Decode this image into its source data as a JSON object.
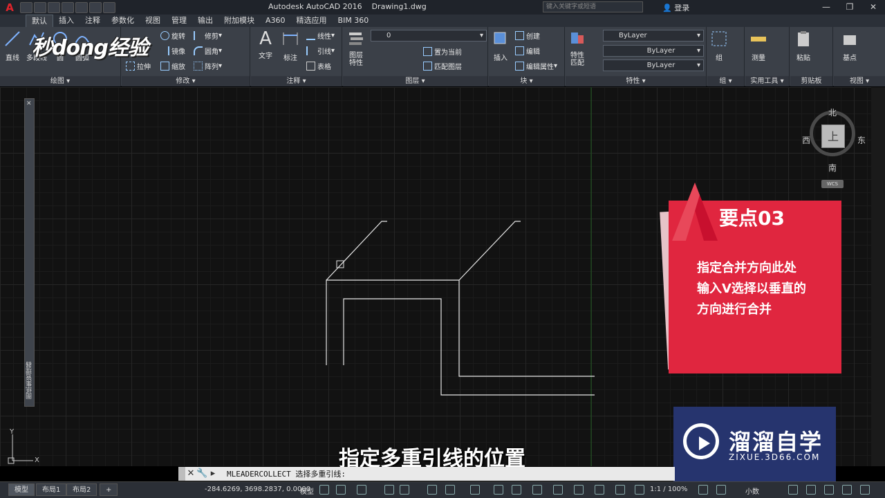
{
  "title_bar": {
    "app_title": "Autodesk AutoCAD 2016    Drawing1.dwg",
    "search_placeholder": "键入关键字或短语",
    "login_label": "登录",
    "minimize": "—",
    "restore": "❐",
    "close": "✕"
  },
  "ribbon_tabs": [
    "默认",
    "插入",
    "注释",
    "参数化",
    "视图",
    "管理",
    "输出",
    "附加模块",
    "A360",
    "精选应用",
    "BIM 360"
  ],
  "ribbon": {
    "draw": {
      "title": "绘图",
      "line": "直线",
      "polyline": "多段线",
      "circle": "圆",
      "arc": "圆弧"
    },
    "modify": {
      "title": "修改",
      "rotate": "旋转",
      "trim": "修剪",
      "mirror": "镜像",
      "fillet": "圆角",
      "stretch": "拉伸",
      "scale": "缩放",
      "array": "阵列"
    },
    "annotation": {
      "title": "注释",
      "text": "文字",
      "dimension": "标注",
      "linear": "线性",
      "leader": "引线",
      "table": "表格"
    },
    "layers": {
      "title": "图层",
      "layer_props": "图层\n特性",
      "layer_value": "0",
      "set_current": "置为当前",
      "match_layer": "匹配图层"
    },
    "block": {
      "title": "块",
      "insert": "插入",
      "create": "创建",
      "edit": "编辑",
      "edit_attr": "编辑属性"
    },
    "properties": {
      "title": "特性",
      "match": "特性\n匹配",
      "color": "ByLayer",
      "linetype": "ByLayer",
      "lineweight": "ByLayer"
    },
    "groups": {
      "title": "组",
      "group": "组"
    },
    "utilities": {
      "title": "实用工具",
      "measure": "测量"
    },
    "clipboard": {
      "title": "剪贴板",
      "paste": "粘贴"
    },
    "view": {
      "title": "视图",
      "base": "基点"
    }
  },
  "watermark_logo": "秒dong经验",
  "palette_label": "图纸集管理器",
  "viewcube": {
    "north": "北",
    "south": "南",
    "east": "东",
    "west": "西",
    "face": "上",
    "wcs": "WCS"
  },
  "tip_card": {
    "title": "要点03",
    "lines": [
      "指定合并方向此处",
      "输入V选择以垂直的",
      "方向进行合并"
    ]
  },
  "brand": {
    "name": "溜溜自学",
    "url": "ZIXUE.3D66.COM"
  },
  "subtitle": "指定多重引线的位置",
  "command_line": {
    "text": "MLEADERCOLLECT 选择多重引线:"
  },
  "status_bar": {
    "layout_tabs": [
      "模型",
      "布局1",
      "布局2"
    ],
    "add_tab": "+",
    "coordinates": "-284.6269, 3698.2837, 0.0000",
    "space": "模型",
    "annotation_scale": "1:1 / 100%",
    "units": "小数"
  },
  "ucs": {
    "x_label": "X",
    "y_label": "Y"
  },
  "colors": {
    "tip_red": "#e0263f",
    "brand_blue": "#26346e",
    "canvas": "#121212"
  }
}
